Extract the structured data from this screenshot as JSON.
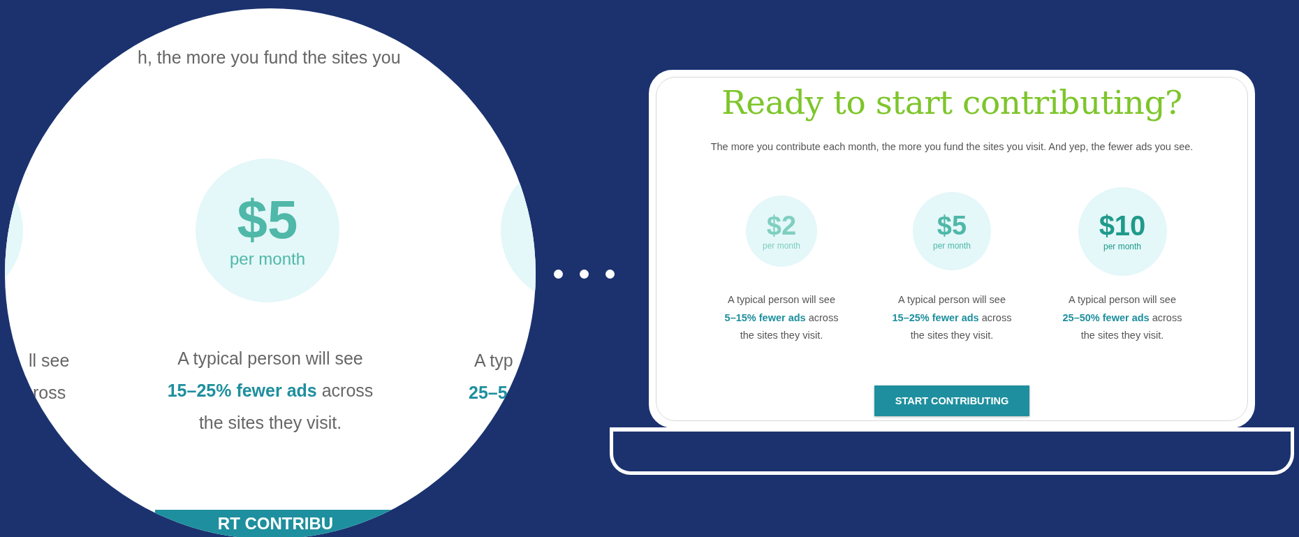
{
  "magnifier": {
    "subtitle_fragment": "h, the more you fund the sites you",
    "left_fragments": [
      "ll see",
      "ross"
    ],
    "tier": {
      "amount": "$5",
      "period": "per month",
      "color": "#4fb8a8",
      "lines": [
        "A typical person will see",
        "**15–25% fewer ads** across",
        "the sites they visit."
      ]
    },
    "right_fragments": [
      "A typ",
      "25–5"
    ],
    "button_fragment": "RT CONTRIBU"
  },
  "page": {
    "title": "Ready to start contributing?",
    "subtitle": "The more you contribute each month, the more you fund the sites you visit. And yep, the fewer ads you see.",
    "tiers": [
      {
        "amount": "$2",
        "period": "per month",
        "color": "#7fcfc0",
        "lines": [
          "A typical person will see",
          "**5–15% fewer ads** across",
          "the sites they visit."
        ]
      },
      {
        "amount": "$5",
        "period": "per month",
        "color": "#4fb8a8",
        "lines": [
          "A typical person will see",
          "**15–25% fewer ads** across",
          "the sites they visit."
        ]
      },
      {
        "amount": "$10",
        "period": "per month",
        "color": "#1f9a8a",
        "lines": [
          "A typical person will see",
          "**25–50% fewer ads** across",
          "the sites they visit."
        ]
      }
    ],
    "button": "START CONTRIBUTING"
  }
}
